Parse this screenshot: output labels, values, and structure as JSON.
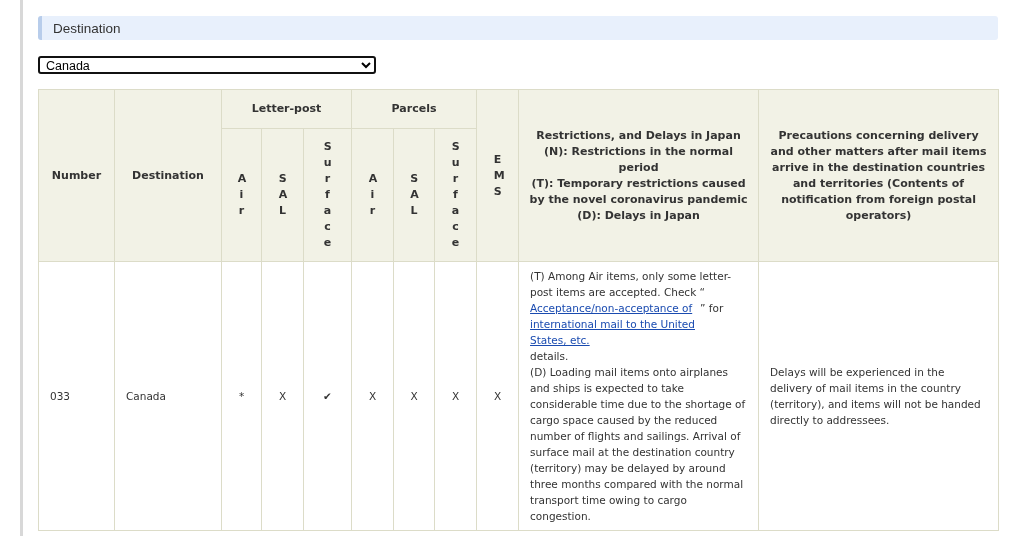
{
  "section_title": "Destination",
  "destination_select": {
    "value": "Canada"
  },
  "table": {
    "columns": {
      "number": "Number",
      "destination": "Destination",
      "groups": [
        {
          "label": "Letter-post",
          "sub": [
            "Air",
            "SAL",
            "Surface"
          ]
        },
        {
          "label": "Parcels",
          "sub": [
            "Air",
            "SAL",
            "Surface"
          ]
        }
      ],
      "ems": "EMS",
      "restrictions": "Restrictions, and Delays in Japan\n(N): Restrictions in the normal period\n(T): Temporary restrictions caused by the novel coronavirus pandemic\n(D): Delays in Japan",
      "precautions": "Precautions concerning delivery and other matters after mail items arrive in the destination countries and territories (Contents of notification from foreign postal operators)"
    },
    "rows": [
      {
        "number": "033",
        "destination": "Canada",
        "marks": [
          "*",
          "X",
          "✔",
          "X",
          "X",
          "X",
          "X"
        ],
        "restrictions": {
          "before_link": "(T) Among Air items, only some letter-post items are accepted. Check “",
          "link": "Acceptance/non-acceptance of international mail to the United States, etc.",
          "after_link": "” for details.\n(D) Loading mail items onto airplanes and ships is expected to take considerable time due to the shortage of cargo space caused by the reduced number of flights and sailings. Arrival of surface mail at the destination country (territory) may be delayed by around three months compared with the normal transport time owing to cargo congestion."
        },
        "precautions": "Delays will be experienced in the delivery of mail items in the country (territory), and items will not be handed directly to addressees."
      }
    ]
  }
}
